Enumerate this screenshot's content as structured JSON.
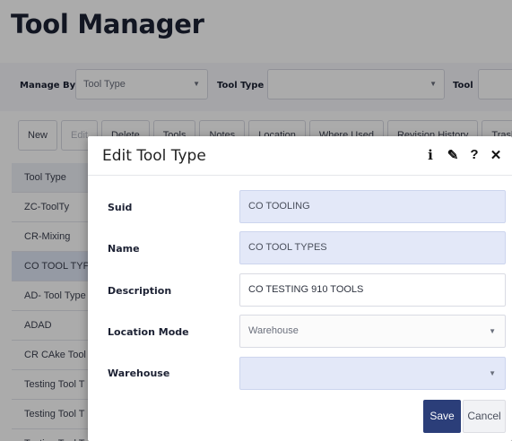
{
  "page": {
    "title": "Tool Manager",
    "filters": {
      "manage_by_label": "Manage By",
      "manage_by_value": "Tool Type",
      "tool_type_label": "Tool Type",
      "tool_type_value": "",
      "tool_label": "Tool",
      "tool_value": ""
    },
    "toolbar": [
      "New",
      "Edit",
      "Delete",
      "Tools",
      "Notes",
      "Location",
      "Where Used",
      "Revision History",
      "Trash"
    ],
    "grid": {
      "header": "Tool Type",
      "rows": [
        "ZC-ToolTy",
        "CR-Mixing",
        "CO TOOL TYPES",
        "AD- Tool Type",
        "ADAD",
        "CR CAke Tool",
        "Testing Tool T",
        "Testing Tool T",
        "Testing Tool T"
      ],
      "selected_index": 2
    }
  },
  "modal": {
    "title": "Edit Tool Type",
    "icons": {
      "info": "i",
      "edit": "✎",
      "help": "?",
      "close": "✕"
    },
    "fields": {
      "suid_label": "Suid",
      "suid_value": "CO TOOLING",
      "name_label": "Name",
      "name_value": "CO TOOL TYPES",
      "description_label": "Description",
      "description_value": "CO TESTING 910 TOOLS",
      "location_mode_label": "Location Mode",
      "location_mode_value": "Warehouse",
      "warehouse_label": "Warehouse",
      "warehouse_value": ""
    },
    "save_label": "Save",
    "cancel_label": "Cancel"
  },
  "colors": {
    "save_button": "#2b3e79",
    "readonly_field": "#e3e8f8",
    "page_title": "#1c2133"
  }
}
